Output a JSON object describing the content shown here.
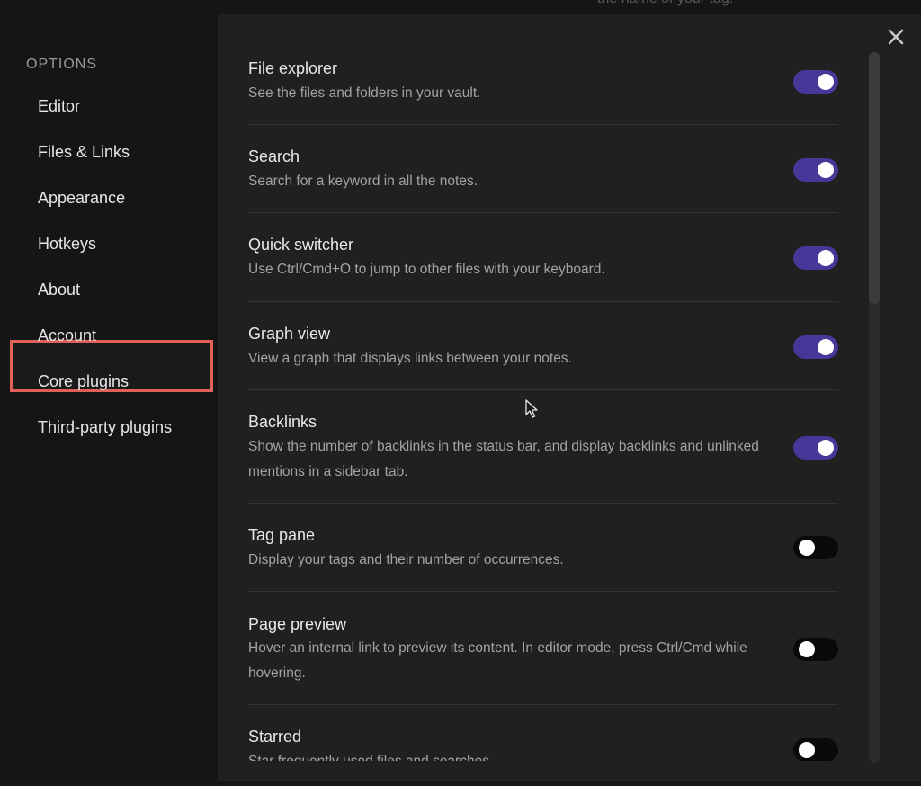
{
  "background": {
    "hint_text": "the name of your tag."
  },
  "sidebar": {
    "heading": "OPTIONS",
    "items": [
      {
        "label": "Editor"
      },
      {
        "label": "Files & Links"
      },
      {
        "label": "Appearance"
      },
      {
        "label": "Hotkeys"
      },
      {
        "label": "About"
      },
      {
        "label": "Account"
      },
      {
        "label": "Core plugins",
        "selected": true
      },
      {
        "label": "Third-party plugins"
      }
    ]
  },
  "plugins": [
    {
      "title": "File explorer",
      "description": "See the files and folders in your vault.",
      "enabled": true
    },
    {
      "title": "Search",
      "description": "Search for a keyword in all the notes.",
      "enabled": true
    },
    {
      "title": "Quick switcher",
      "description": "Use Ctrl/Cmd+O to jump to other files with your keyboard.",
      "enabled": true
    },
    {
      "title": "Graph view",
      "description": "View a graph that displays links between your notes.",
      "enabled": true
    },
    {
      "title": "Backlinks",
      "description": "Show the number of backlinks in the status bar, and display backlinks and unlinked mentions in a sidebar tab.",
      "enabled": true
    },
    {
      "title": "Tag pane",
      "description": "Display your tags and their number of occurrences.",
      "enabled": false
    },
    {
      "title": "Page preview",
      "description": "Hover an internal link to preview its content. In editor mode, press Ctrl/Cmd while hovering.",
      "enabled": false
    },
    {
      "title": "Starred",
      "description": "Star frequently used files and searches.",
      "enabled": false
    }
  ],
  "colors": {
    "toggle_on": "#483699",
    "toggle_off": "#0a0a0a",
    "highlight": "#e0605a"
  },
  "icons": {
    "close": "close-icon",
    "cursor": "mouse-pointer-icon"
  }
}
